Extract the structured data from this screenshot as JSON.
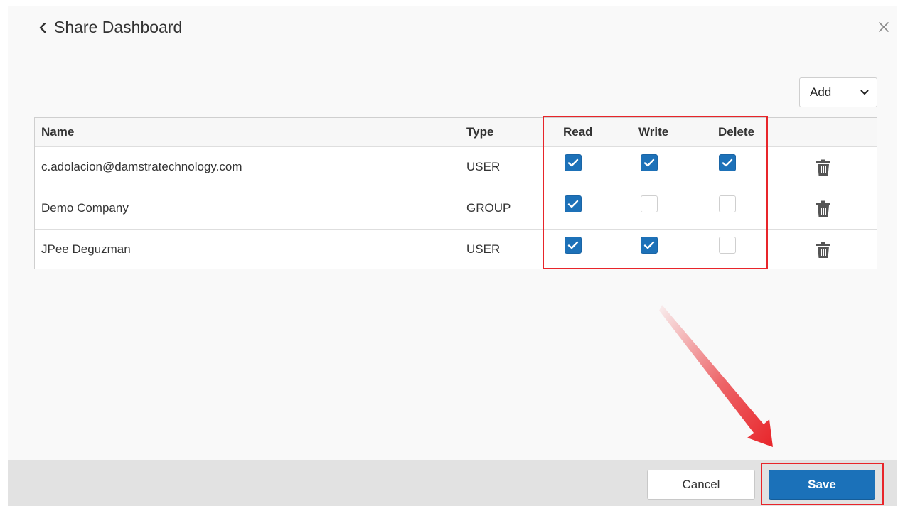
{
  "dialog": {
    "title": "Share Dashboard",
    "back_icon": "chevron-left-icon",
    "close_icon": "close-icon"
  },
  "add_select": {
    "selected": "Add",
    "icon": "chevron-down-icon"
  },
  "table": {
    "headers": {
      "name": "Name",
      "type": "Type",
      "read": "Read",
      "write": "Write",
      "delete": "Delete"
    },
    "rows": [
      {
        "name": "c.adolacion@damstratechnology.com",
        "type": "USER",
        "read": true,
        "write": true,
        "delete": true
      },
      {
        "name": "Demo Company",
        "type": "GROUP",
        "read": true,
        "write": false,
        "delete": false
      },
      {
        "name": "JPee Deguzman",
        "type": "USER",
        "read": true,
        "write": true,
        "delete": false
      }
    ]
  },
  "footer": {
    "cancel_label": "Cancel",
    "save_label": "Save"
  },
  "colors": {
    "accent": "#1d71b8",
    "annotation": "#e8252a",
    "footer_bg": "#e2e2e2"
  }
}
